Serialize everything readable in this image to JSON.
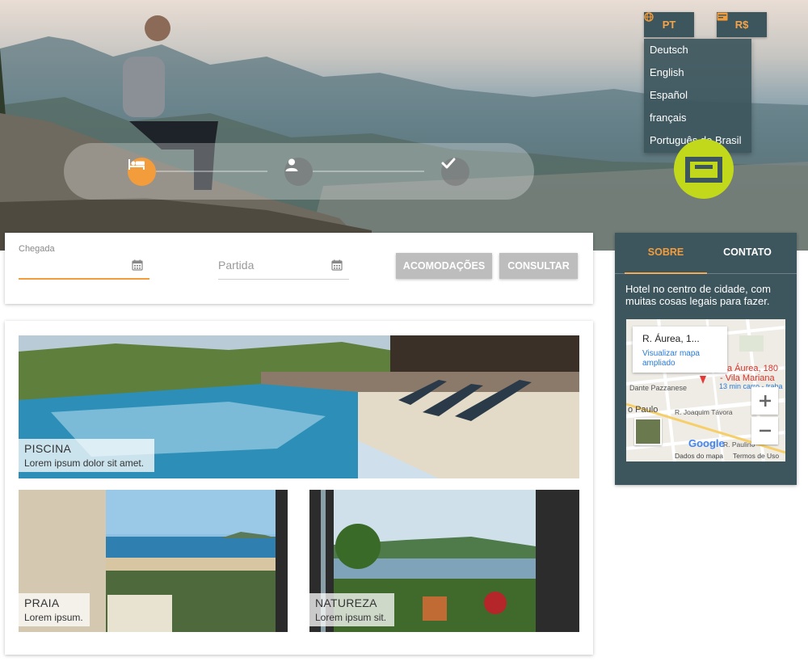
{
  "header": {
    "language_button": "PT",
    "currency_button": "R$",
    "language_menu": [
      "Deutsch",
      "English",
      "Español",
      "français",
      "Português do Brasil"
    ],
    "steps": [
      "bed-icon",
      "person-icon",
      "check-icon"
    ]
  },
  "search": {
    "checkin_label": "Chegada",
    "checkout_placeholder": "Partida",
    "buttons": [
      "ACOMODAÇÕES",
      "CONSULTAR"
    ]
  },
  "sidebar": {
    "tabs": [
      "SOBRE",
      "CONTATO"
    ],
    "active_tab": "SOBRE",
    "description": "Hotel no centro de cidade, com muitas cosas legais para fazer.",
    "map": {
      "popup_address": "R. Áurea, 1...",
      "popup_link": "Visualizar mapa ampliado",
      "label_address": "a Áurea, 180",
      "label_area": "- Vila Mariana",
      "label_route": "13 min carro - traba",
      "street_1": "Dante Pazzanese",
      "street_2": "R. Joaquim Távora",
      "street_3": "R. Paulino",
      "city": "o Paulo",
      "google": "Google",
      "footer_data": "Dados do mapa",
      "footer_terms": "Termos de Uso"
    }
  },
  "gallery": [
    {
      "title": "PISCINA",
      "subtitle": "Lorem ipsum dolor sit amet."
    },
    {
      "title": "PRAIA",
      "subtitle": "Lorem ipsum."
    },
    {
      "title": "NATUREZA",
      "subtitle": "Lorem ipsum sit."
    }
  ],
  "colors": {
    "accent": "#f39c3c",
    "panel": "#3d565e",
    "button_gray": "#bdbdbd",
    "logo": "#c2d81a"
  }
}
